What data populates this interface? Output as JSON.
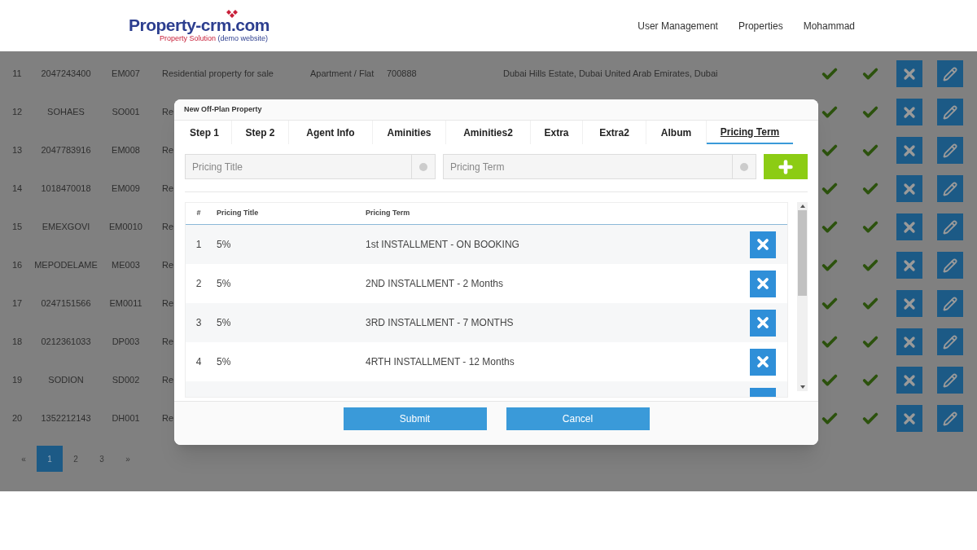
{
  "header": {
    "logo": {
      "name": "Property-crm",
      "suffix": ".com",
      "tagline": "Property Solution",
      "tagline_note": "(demo website)"
    },
    "nav": [
      {
        "label": "User Management"
      },
      {
        "label": "Properties"
      },
      {
        "label": "Mohammad"
      }
    ]
  },
  "listing": {
    "rows": [
      {
        "index": "11",
        "code_1": "2047243400",
        "code_2": "EM007",
        "description": "Residential property for sale",
        "type": "Apartment / Flat",
        "number": "700888",
        "address": "Dubai Hills Estate, Dubai United Arab Emirates, Dubai",
        "check_1": true,
        "check_2": true
      },
      {
        "index": "12",
        "code_1": "SOHAES",
        "code_2": "SO001",
        "description": "Re",
        "check_1": true,
        "check_2": true
      },
      {
        "index": "13",
        "code_1": "2047783916",
        "code_2": "EM008",
        "description": "Re",
        "check_1": true,
        "check_2": true
      },
      {
        "index": "14",
        "code_1": "1018470018",
        "code_2": "EM009",
        "description": "Re",
        "check_1": true,
        "check_2": true
      },
      {
        "index": "15",
        "code_1": "EMEXGOVI",
        "code_2": "EM0010",
        "description": "Re",
        "check_1": true,
        "check_2": true
      },
      {
        "index": "16",
        "code_1": "MEPODELAME",
        "code_2": "ME003",
        "description": "Re",
        "check_1": true,
        "check_2": true
      },
      {
        "index": "17",
        "code_1": "0247151566",
        "code_2": "EM0011",
        "description": "Re",
        "check_1": true,
        "check_2": true
      },
      {
        "index": "18",
        "code_1": "0212361033",
        "code_2": "DP003",
        "description": "Re",
        "check_1": true,
        "check_2": true
      },
      {
        "index": "19",
        "code_1": "SODION",
        "code_2": "SD002",
        "description": "Re",
        "check_1": true,
        "check_2": true
      },
      {
        "index": "20",
        "code_1": "1352212143",
        "code_2": "DH001",
        "description": "Re",
        "check_1": true,
        "check_2": true
      }
    ]
  },
  "pagination": {
    "prev": "«",
    "pages": [
      {
        "label": "1",
        "selected": true
      },
      {
        "label": "2",
        "selected": false
      },
      {
        "label": "3",
        "selected": false
      }
    ],
    "next": "»"
  },
  "modal": {
    "title": "New Off-Plan Property",
    "tabs": [
      {
        "label": "Step 1",
        "selected": false
      },
      {
        "label": "Step 2",
        "selected": false
      },
      {
        "label": "Agent Info",
        "selected": false
      },
      {
        "label": "Aminities",
        "selected": false
      },
      {
        "label": "Aminities2",
        "selected": false
      },
      {
        "label": "Extra",
        "selected": false
      },
      {
        "label": "Extra2",
        "selected": false
      },
      {
        "label": "Album",
        "selected": false
      },
      {
        "label": "Pricing Term",
        "selected": true
      }
    ],
    "fields": [
      {
        "placeholder": "Pricing Title"
      },
      {
        "placeholder": "Pricing Term"
      }
    ],
    "table": {
      "columns": [
        "#",
        "Pricing Title",
        "Pricing Term"
      ],
      "rows": [
        {
          "index": "1",
          "title": "5%",
          "term": "1st INSTALLMENT - ON BOOKING"
        },
        {
          "index": "2",
          "title": "5%",
          "term": "2ND INSTALLMENT - 2 Months"
        },
        {
          "index": "3",
          "title": "5%",
          "term": "3RD INSTALLMENT - 7 MONTHS"
        },
        {
          "index": "4",
          "title": "5%",
          "term": "4RTH INSTALLMENT - 12 Months"
        }
      ]
    },
    "buttons": [
      "Submit",
      "Cancel"
    ]
  }
}
